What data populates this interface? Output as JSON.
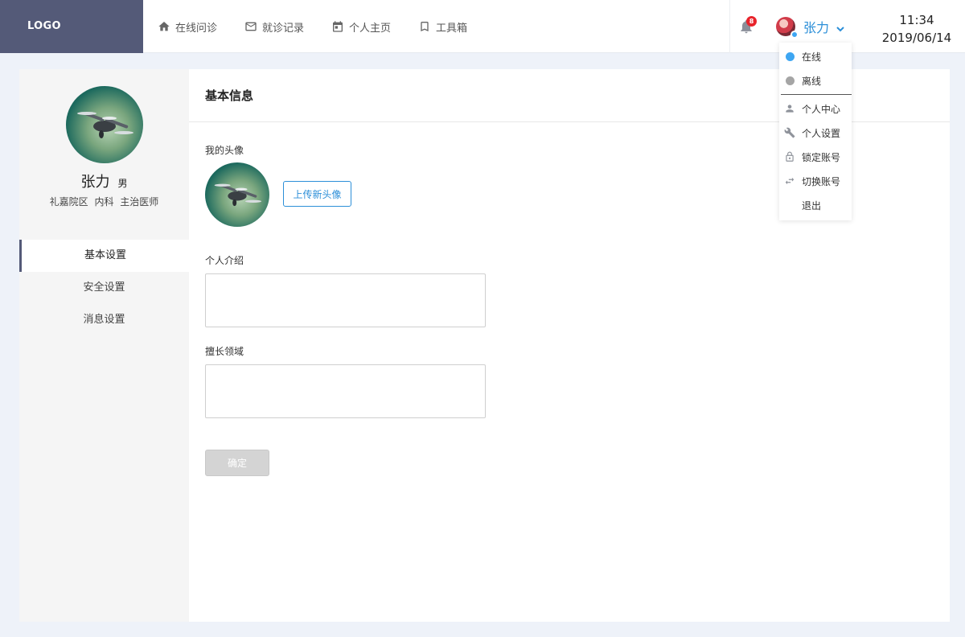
{
  "header": {
    "logo": "LOGO",
    "nav": [
      {
        "label": "在线问诊",
        "icon": "home-icon"
      },
      {
        "label": "就诊记录",
        "icon": "mail-icon"
      },
      {
        "label": "个人主页",
        "icon": "calendar-icon"
      },
      {
        "label": "工具箱",
        "icon": "bookmark-icon"
      }
    ],
    "notification_count": "8",
    "user_name": "张力",
    "time": "11:34",
    "date": "2019/06/14"
  },
  "dropdown": {
    "status_online": "在线",
    "status_offline": "离线",
    "personal_center": "个人中心",
    "personal_settings": "个人设置",
    "lock_account": "锁定账号",
    "switch_account": "切换账号",
    "logout": "退出"
  },
  "profile": {
    "name": "张力",
    "gender": "男",
    "meta": "礼嘉院区 内科 主治医师"
  },
  "sidebar": {
    "items": [
      {
        "label": "基本设置",
        "active": true
      },
      {
        "label": "安全设置",
        "active": false
      },
      {
        "label": "消息设置",
        "active": false
      }
    ]
  },
  "main": {
    "title": "基本信息",
    "avatar_label": "我的头像",
    "upload_label": "上传新头像",
    "intro_label": "个人介绍",
    "intro_value": "",
    "expertise_label": "擅长领域",
    "expertise_value": "",
    "confirm_label": "确定"
  },
  "colors": {
    "accent": "#2c8fd8",
    "logo_bg": "#545a78",
    "online": "#3ea6f2",
    "badge": "#e8232b"
  }
}
